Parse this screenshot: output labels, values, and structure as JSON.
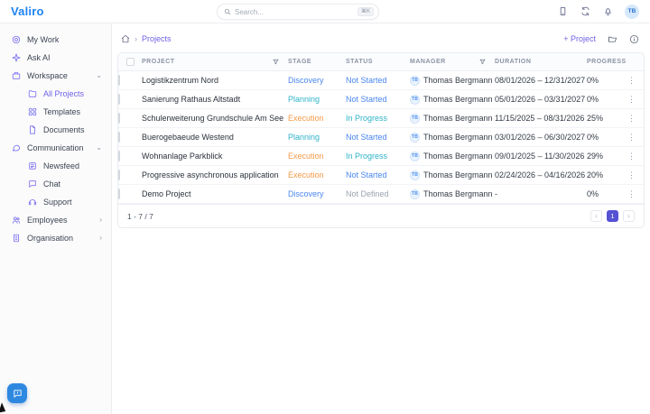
{
  "app": {
    "name": "Valiro"
  },
  "topbar": {
    "search_placeholder": "Search...",
    "search_shortcut": "⌘K",
    "avatar_initials": "TB"
  },
  "icons": {
    "kebab": "⋮",
    "chevron_down": "⌄",
    "chevron_right": "›",
    "breadcrumb_separator": "›",
    "pagination_prev": "‹",
    "pagination_next": "›"
  },
  "sidebar": {
    "items": [
      {
        "label": "My Work"
      },
      {
        "label": "Ask AI"
      },
      {
        "label": "Workspace"
      },
      {
        "label": "All Projects"
      },
      {
        "label": "Templates"
      },
      {
        "label": "Documents"
      },
      {
        "label": "Communication"
      },
      {
        "label": "Newsfeed"
      },
      {
        "label": "Chat"
      },
      {
        "label": "Support"
      },
      {
        "label": "Employees"
      },
      {
        "label": "Organisation"
      }
    ]
  },
  "breadcrumb": {
    "current": "Projects"
  },
  "header_actions": {
    "new_project": "+ Project"
  },
  "table": {
    "columns": [
      "PROJECT",
      "STAGE",
      "STATUS",
      "MANAGER",
      "DURATION",
      "PROGRESS"
    ],
    "rows": [
      {
        "project": "Logistikzentrum Nord",
        "stage": "Discovery",
        "stage_color": "blue",
        "status": "Not Started",
        "status_color": "blue",
        "manager": "Thomas Bergmann",
        "manager_initials": "TB",
        "duration": "08/01/2026 – 12/31/2027",
        "progress": "0%"
      },
      {
        "project": "Sanierung Rathaus Altstadt",
        "stage": "Planning",
        "stage_color": "cyan",
        "status": "Not Started",
        "status_color": "blue",
        "manager": "Thomas Bergmann",
        "manager_initials": "TB",
        "duration": "05/01/2026 – 03/31/2027",
        "progress": "0%"
      },
      {
        "project": "Schulerweiterung Grundschule Am See",
        "stage": "Execution",
        "stage_color": "orange",
        "status": "In Progress",
        "status_color": "cyan",
        "manager": "Thomas Bergmann",
        "manager_initials": "TB",
        "duration": "11/15/2025 – 08/31/2026",
        "progress": "25%"
      },
      {
        "project": "Buerogebaeude Westend",
        "stage": "Planning",
        "stage_color": "cyan",
        "status": "Not Started",
        "status_color": "blue",
        "manager": "Thomas Bergmann",
        "manager_initials": "TB",
        "duration": "03/01/2026 – 06/30/2027",
        "progress": "0%"
      },
      {
        "project": "Wohnanlage Parkblick",
        "stage": "Execution",
        "stage_color": "orange",
        "status": "In Progress",
        "status_color": "cyan",
        "manager": "Thomas Bergmann",
        "manager_initials": "TB",
        "duration": "09/01/2025 – 11/30/2026",
        "progress": "29%"
      },
      {
        "project": "Progressive asynchronous application",
        "stage": "Execution",
        "stage_color": "orange",
        "status": "Not Started",
        "status_color": "blue",
        "manager": "Thomas Bergmann",
        "manager_initials": "TB",
        "duration": "02/24/2026 – 04/16/2026",
        "progress": "20%"
      },
      {
        "project": "Demo Project",
        "stage": "Discovery",
        "stage_color": "blue",
        "status": "Not Defined",
        "status_color": "gray",
        "manager": "Thomas Bergmann",
        "manager_initials": "TB",
        "duration": "-",
        "progress": "0%"
      }
    ]
  },
  "pagination": {
    "range": "1 - 7 / 7",
    "current_page": "1"
  },
  "palette": {
    "blue": "#4a86f0",
    "cyan": "#2eb3ca",
    "orange": "#f59a47",
    "gray": "#9aa3ae",
    "accent_purple": "#6f61e8",
    "logo_blue": "#1d82f5",
    "pagination_active": "#5552d4",
    "chat_widget_blue": "#2f88e0"
  }
}
